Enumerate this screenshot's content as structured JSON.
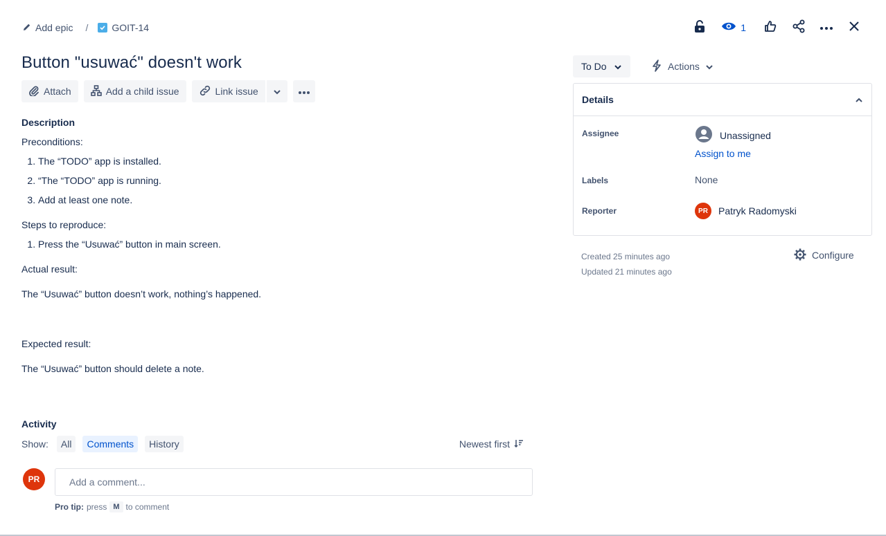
{
  "breadcrumb": {
    "add_epic": "Add epic",
    "separator": "/",
    "issue_key": "GOIT-14"
  },
  "header": {
    "watch_count": "1"
  },
  "issue": {
    "title": "Button \"usuwać\" doesn't work"
  },
  "toolbar": {
    "attach": "Attach",
    "add_child": "Add a child issue",
    "link_issue": "Link issue"
  },
  "description": {
    "label": "Description",
    "preconditions_label": "Preconditions:",
    "preconditions": [
      "The “TODO” app is installed.",
      "“The “TODO” app is running.",
      "Add at least one note."
    ],
    "steps_label": "Steps to reproduce:",
    "steps": [
      "Press the “Usuwać” button in main screen."
    ],
    "actual_label": "Actual result:",
    "actual": "The “Usuwać” button doesn’t work, nothing’s happened.",
    "expected_label": "Expected result:",
    "expected": "The “Usuwać” button should delete a note."
  },
  "activity": {
    "label": "Activity",
    "show_label": "Show:",
    "filters": [
      "All",
      "Comments",
      "History"
    ],
    "active_filter": "Comments",
    "sort": "Newest first",
    "comment_placeholder": "Add a comment...",
    "user_initials": "PR",
    "protip_label": "Pro tip:",
    "protip_press": "press",
    "protip_key": "M",
    "protip_suffix": "to comment"
  },
  "sidebar": {
    "status": "To Do",
    "actions": "Actions",
    "details_title": "Details",
    "assignee_label": "Assignee",
    "assignee_value": "Unassigned",
    "assign_to_me": "Assign to me",
    "labels_label": "Labels",
    "labels_value": "None",
    "reporter_label": "Reporter",
    "reporter_initials": "PR",
    "reporter_name": "Patryk Radomyski",
    "created": "Created 25 minutes ago",
    "updated": "Updated 21 minutes ago",
    "configure": "Configure"
  },
  "colors": {
    "accent": "#0052cc",
    "avatar": "#de350b",
    "checkbox": "#4bade8"
  }
}
